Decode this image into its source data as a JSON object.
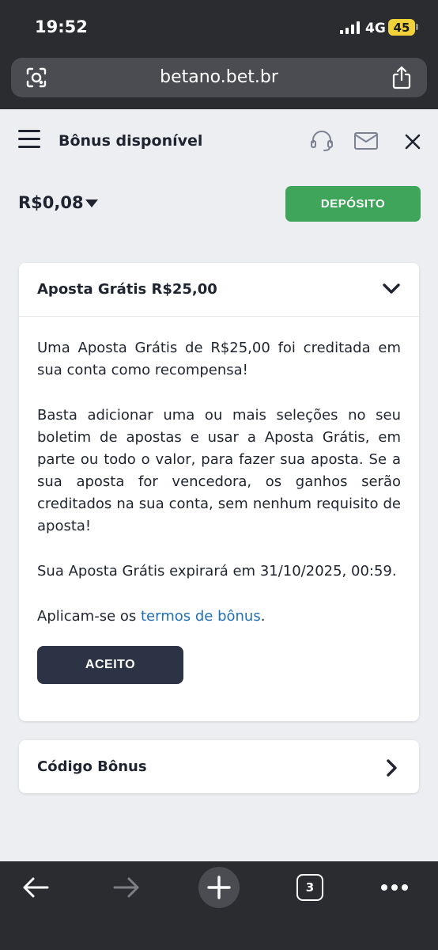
{
  "status_bar": {
    "time": "19:52",
    "network": "4G",
    "battery": "45"
  },
  "browser": {
    "url": "betano.bet.br",
    "tab_count": "3"
  },
  "header": {
    "title": "Bônus disponível"
  },
  "balance": {
    "amount": "R$0,08"
  },
  "deposit_button": {
    "label": "DEPÓSITO"
  },
  "bonus_card": {
    "title": "Aposta Grátis R$25,00",
    "paragraph1": "Uma Aposta Grátis de R$25,00 foi creditada em sua conta como recompensa!",
    "paragraph2": "Basta adicionar uma ou mais seleções no seu boletim de apostas e usar a Aposta Grátis, em parte ou todo o valor, para fazer sua aposta. Se a sua aposta for vencedora, os ganhos serão creditados na sua conta, sem nenhum requisito de aposta!",
    "paragraph3": "Sua Aposta Grátis expirará em 31/10/2025, 00:59.",
    "terms_prefix": "Aplicam-se os ",
    "terms_link": "termos de bônus",
    "terms_suffix": ".",
    "accept_label": "ACEITO"
  },
  "code_card": {
    "title": "Código Bônus"
  },
  "colors": {
    "brand_green": "#3ea55a",
    "dark_button": "#2b3344",
    "link": "#1f6fb8"
  }
}
